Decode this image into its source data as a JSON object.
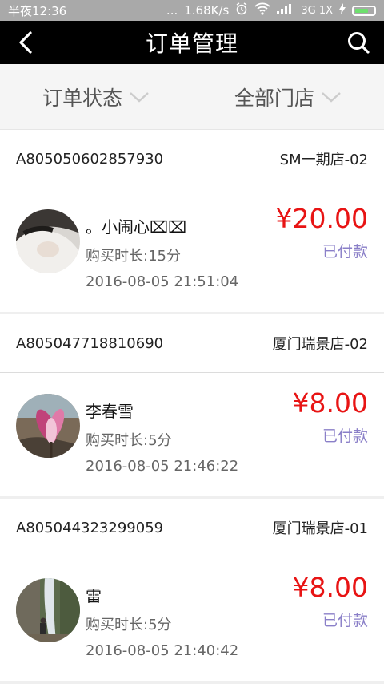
{
  "status_bar": {
    "time": "半夜12:36",
    "dots": "...",
    "speed": "1.68K/s",
    "signal_label": "3G 1X"
  },
  "nav": {
    "title": "订单管理"
  },
  "filters": [
    {
      "label": "订单状态"
    },
    {
      "label": "全部门店"
    }
  ],
  "orders": [
    {
      "order_no": "A805050602857930",
      "store": "SM一期店-02",
      "customer": "。小闹心⌧⌧",
      "duration": "购买时长:15分",
      "time": "2016-08-05 21:51:04",
      "price": "¥20.00",
      "status": "已付款"
    },
    {
      "order_no": "A805047718810690",
      "store": "厦门瑞景店-02",
      "customer": "李春雪",
      "duration": "购买时长:5分",
      "time": "2016-08-05 21:46:22",
      "price": "¥8.00",
      "status": "已付款"
    },
    {
      "order_no": "A805044323299059",
      "store": "厦门瑞景店-01",
      "customer": "雷",
      "duration": "购买时长:5分",
      "time": "2016-08-05 21:40:42",
      "price": "¥8.00",
      "status": "已付款"
    }
  ],
  "colors": {
    "price": "#e81414",
    "paid_status": "#8a7fc8",
    "nav_bg": "#000000"
  }
}
